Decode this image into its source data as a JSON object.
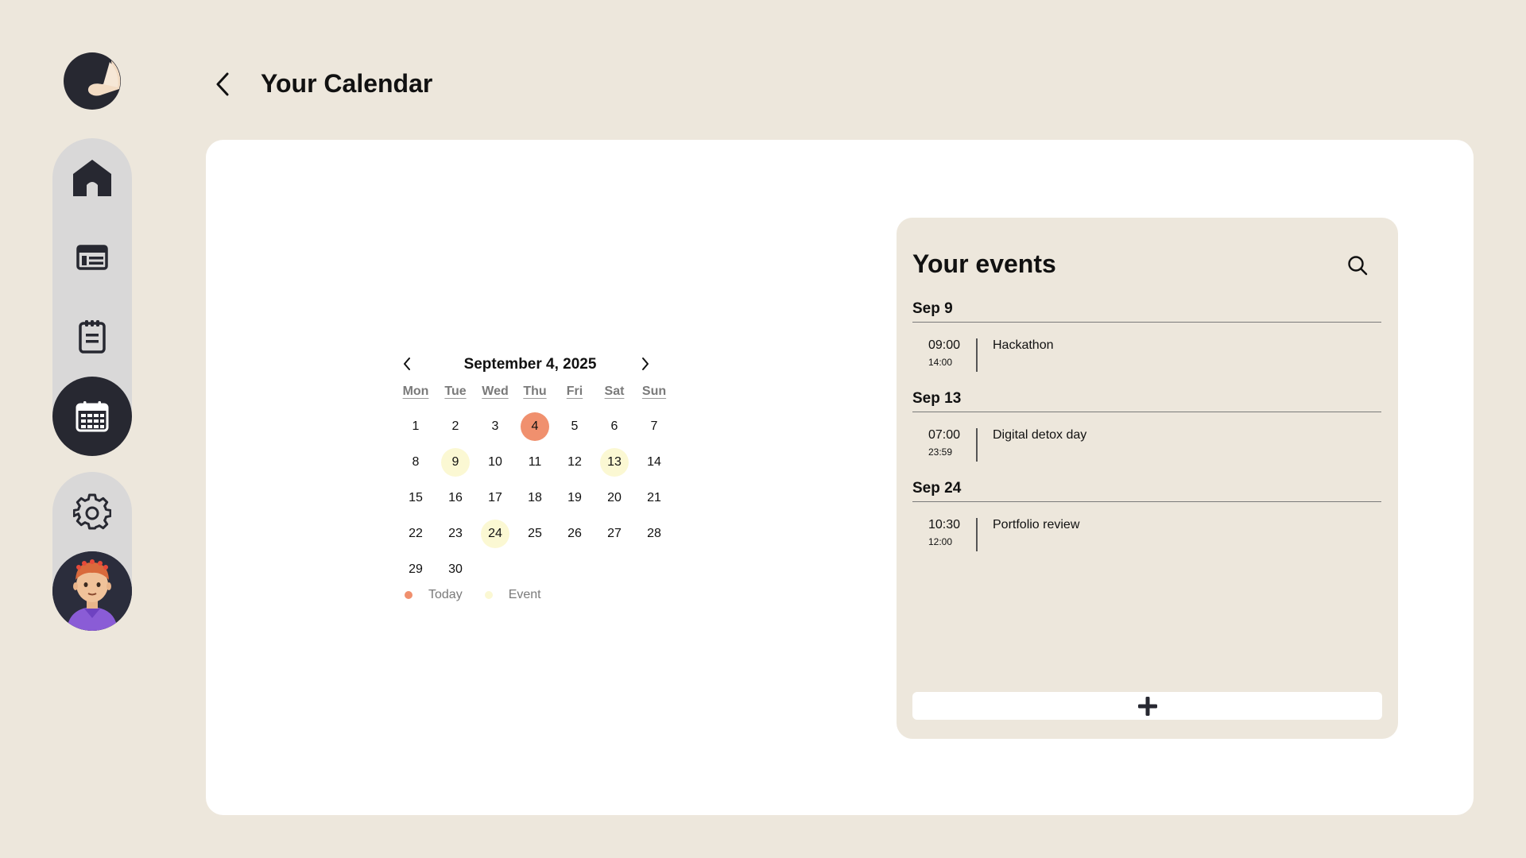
{
  "header": {
    "title": "Your Calendar"
  },
  "sidebar": {
    "items": [
      {
        "icon": "home-icon",
        "active": false
      },
      {
        "icon": "list-icon",
        "active": false
      },
      {
        "icon": "clipboard-icon",
        "active": false
      },
      {
        "icon": "calendar-icon",
        "active": true
      },
      {
        "icon": "gear-icon",
        "active": false
      }
    ]
  },
  "calendar": {
    "title": "September 4, 2025",
    "weekdays": [
      "Mon",
      "Tue",
      "Wed",
      "Thu",
      "Fri",
      "Sat",
      "Sun"
    ],
    "today": 4,
    "event_days": [
      9,
      13,
      24
    ],
    "days": [
      "1",
      "2",
      "3",
      "4",
      "5",
      "6",
      "7",
      "8",
      "9",
      "10",
      "11",
      "12",
      "13",
      "14",
      "15",
      "16",
      "17",
      "18",
      "19",
      "20",
      "21",
      "22",
      "23",
      "24",
      "25",
      "26",
      "27",
      "28",
      "29",
      "30"
    ],
    "legend": {
      "today_label": "Today",
      "event_label": "Event"
    }
  },
  "events": {
    "title": "Your events",
    "groups": [
      {
        "date": "Sep 9",
        "items": [
          {
            "start": "09:00",
            "end": "14:00",
            "name": "Hackathon"
          }
        ]
      },
      {
        "date": "Sep 13",
        "items": [
          {
            "start": "07:00",
            "end": "23:59",
            "name": "Digital detox day"
          }
        ]
      },
      {
        "date": "Sep 24",
        "items": [
          {
            "start": "10:30",
            "end": "12:00",
            "name": "Portfolio review"
          }
        ]
      }
    ],
    "add_icon": "plus-icon"
  },
  "colors": {
    "background": "#ede7dc",
    "card": "#ffffff",
    "sidebar_pill": "#d9d8d8",
    "dark": "#272831",
    "today": "#f0906e",
    "event": "#fbf8d3"
  }
}
